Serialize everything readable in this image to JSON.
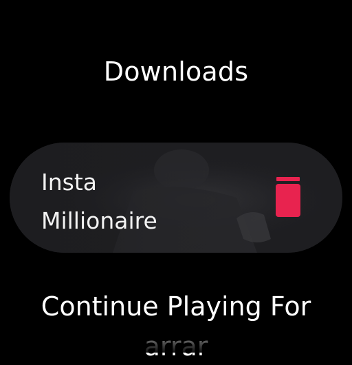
{
  "header": {
    "title": "Downloads"
  },
  "downloads": {
    "items": [
      {
        "title": "Insta Millionaire",
        "delete_icon": "trash-icon",
        "delete_color": "#e8234f"
      }
    ]
  },
  "section": {
    "title": "Continue Playing For",
    "subtitle": "arrar"
  },
  "colors": {
    "background": "#000000",
    "card": "#1f1f22",
    "text": "#ffffff",
    "accent": "#e8234f"
  }
}
